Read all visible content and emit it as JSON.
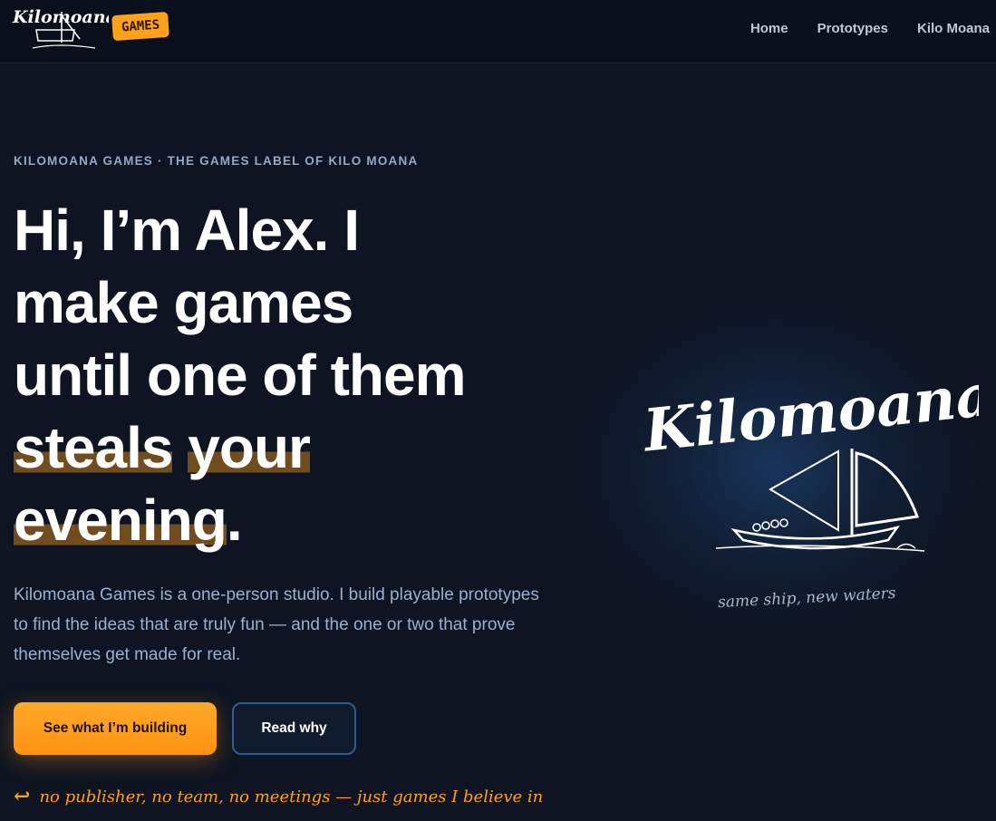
{
  "header": {
    "logo_text": "Kilomoana",
    "badge": "GAMES",
    "nav": [
      "Home",
      "Prototypes",
      "Kilo Moana"
    ]
  },
  "hero": {
    "eyebrow": "KILOMOANA GAMES · THE GAMES LABEL OF KILO MOANA",
    "headline_plain": "Hi, I’m Alex. I make games until one of them",
    "headline_highlight_1": "steals",
    "headline_highlight_2": "your evening",
    "headline_end": ".",
    "lede": "Kilomoana Games is a one-person studio. I build playable prototypes to find the ideas that are truly fun — and the one or two that prove themselves get made for real.",
    "primary_cta": "See what I’m building",
    "secondary_cta": "Read why",
    "footnote": "no publisher, no team, no meetings — just games I believe in",
    "art_logo_text": "Kilomoana",
    "art_tagline": "same ship, new waters"
  },
  "colors": {
    "background": "#0e1421",
    "accent": "#ffa21a",
    "highlight": "#6f4d1f",
    "muted_text": "#9bb0cf"
  }
}
